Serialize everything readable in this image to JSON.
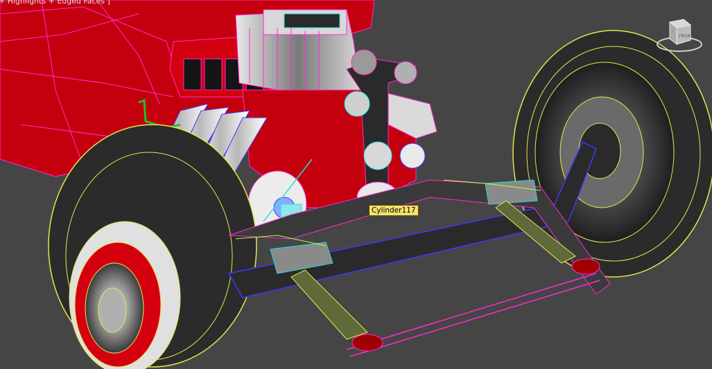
{
  "viewport": {
    "label": "+ Highlights + Edged Faces ]"
  },
  "tooltip": {
    "object_name": "Cylinder117"
  },
  "viewcube": {
    "face_label": "FRONT"
  },
  "colors": {
    "background": "#454545",
    "body_red": "#d0000f",
    "wire_magenta": "#ff2bd0",
    "wire_yellow": "#e6e650",
    "wire_cyan": "#22e0e0",
    "wire_blue": "#3b3bff",
    "tooltip_bg": "#f4e26b"
  },
  "icons": {
    "viewcube": "viewcube-icon"
  }
}
